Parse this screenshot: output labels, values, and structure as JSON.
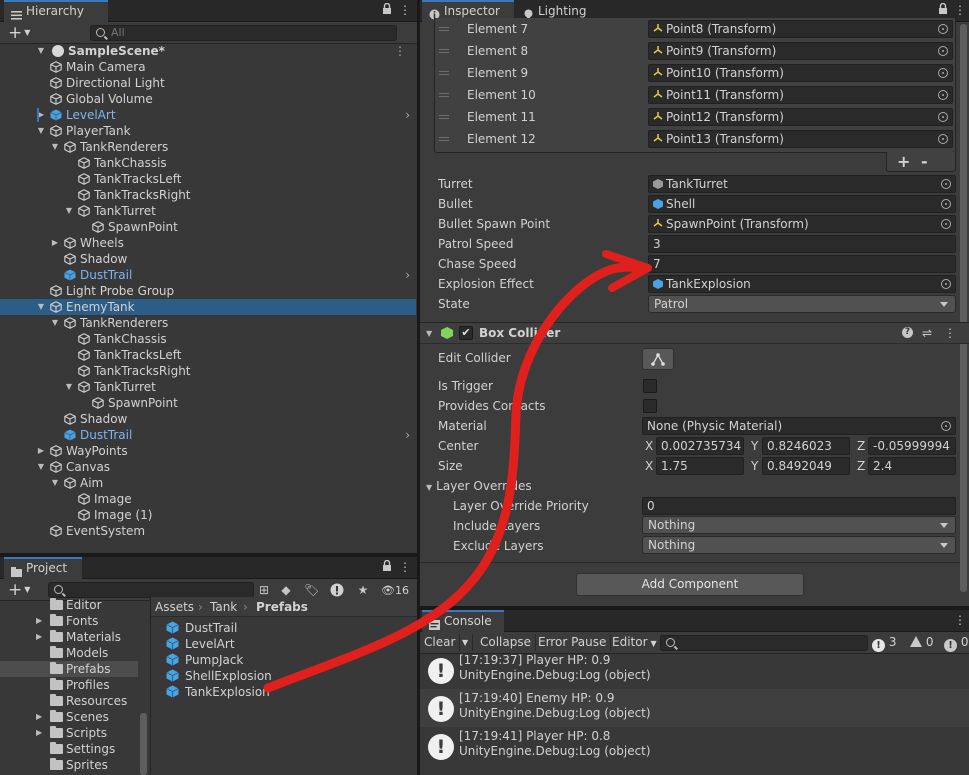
{
  "hierarchy": {
    "tab_label": "Hierarchy",
    "search_placeholder": "All",
    "scene_name": "SampleScene*",
    "items": [
      {
        "label": "Main Camera",
        "depth": 1,
        "arrow": "",
        "prefab": false,
        "sel": false,
        "chev": false
      },
      {
        "label": "Directional Light",
        "depth": 1,
        "arrow": "",
        "prefab": false,
        "sel": false,
        "chev": false
      },
      {
        "label": "Global Volume",
        "depth": 1,
        "arrow": "",
        "prefab": false,
        "sel": false,
        "chev": false
      },
      {
        "label": "LevelArt",
        "depth": 1,
        "arrow": "right",
        "prefab": true,
        "sel": false,
        "chev": true
      },
      {
        "label": "PlayerTank",
        "depth": 1,
        "arrow": "down",
        "prefab": false,
        "sel": false,
        "chev": false
      },
      {
        "label": "TankRenderers",
        "depth": 2,
        "arrow": "down",
        "prefab": false,
        "sel": false,
        "chev": false
      },
      {
        "label": "TankChassis",
        "depth": 3,
        "arrow": "",
        "prefab": false,
        "sel": false,
        "chev": false
      },
      {
        "label": "TankTracksLeft",
        "depth": 3,
        "arrow": "",
        "prefab": false,
        "sel": false,
        "chev": false
      },
      {
        "label": "TankTracksRight",
        "depth": 3,
        "arrow": "",
        "prefab": false,
        "sel": false,
        "chev": false
      },
      {
        "label": "TankTurret",
        "depth": 3,
        "arrow": "down",
        "prefab": false,
        "sel": false,
        "chev": false
      },
      {
        "label": "SpawnPoint",
        "depth": 4,
        "arrow": "",
        "prefab": false,
        "sel": false,
        "chev": false
      },
      {
        "label": "Wheels",
        "depth": 2,
        "arrow": "right",
        "prefab": false,
        "sel": false,
        "chev": false
      },
      {
        "label": "Shadow",
        "depth": 2,
        "arrow": "",
        "prefab": false,
        "sel": false,
        "chev": false
      },
      {
        "label": "DustTrail",
        "depth": 2,
        "arrow": "",
        "prefab": true,
        "sel": false,
        "chev": true
      },
      {
        "label": "Light Probe Group",
        "depth": 1,
        "arrow": "",
        "prefab": false,
        "sel": false,
        "chev": false
      },
      {
        "label": "EnemyTank",
        "depth": 1,
        "arrow": "down",
        "prefab": false,
        "sel": true,
        "chev": false
      },
      {
        "label": "TankRenderers",
        "depth": 2,
        "arrow": "down",
        "prefab": false,
        "sel": false,
        "chev": false
      },
      {
        "label": "TankChassis",
        "depth": 3,
        "arrow": "",
        "prefab": false,
        "sel": false,
        "chev": false
      },
      {
        "label": "TankTracksLeft",
        "depth": 3,
        "arrow": "",
        "prefab": false,
        "sel": false,
        "chev": false
      },
      {
        "label": "TankTracksRight",
        "depth": 3,
        "arrow": "",
        "prefab": false,
        "sel": false,
        "chev": false
      },
      {
        "label": "TankTurret",
        "depth": 3,
        "arrow": "down",
        "prefab": false,
        "sel": false,
        "chev": false
      },
      {
        "label": "SpawnPoint",
        "depth": 4,
        "arrow": "",
        "prefab": false,
        "sel": false,
        "chev": false
      },
      {
        "label": "Shadow",
        "depth": 2,
        "arrow": "",
        "prefab": false,
        "sel": false,
        "chev": false
      },
      {
        "label": "DustTrail",
        "depth": 2,
        "arrow": "",
        "prefab": true,
        "sel": false,
        "chev": true
      },
      {
        "label": "WayPoints",
        "depth": 1,
        "arrow": "right",
        "prefab": false,
        "sel": false,
        "chev": false
      },
      {
        "label": "Canvas",
        "depth": 1,
        "arrow": "down",
        "prefab": false,
        "sel": false,
        "chev": false
      },
      {
        "label": "Aim",
        "depth": 2,
        "arrow": "down",
        "prefab": false,
        "sel": false,
        "chev": false
      },
      {
        "label": "Image",
        "depth": 3,
        "arrow": "",
        "prefab": false,
        "sel": false,
        "chev": false
      },
      {
        "label": "Image (1)",
        "depth": 3,
        "arrow": "",
        "prefab": false,
        "sel": false,
        "chev": false
      },
      {
        "label": "EventSystem",
        "depth": 1,
        "arrow": "",
        "prefab": false,
        "sel": false,
        "chev": false
      }
    ]
  },
  "project": {
    "tab_label": "Project",
    "hidden_count": "16",
    "folders": [
      {
        "label": "Editor",
        "arrow": false,
        "sel": false
      },
      {
        "label": "Fonts",
        "arrow": true,
        "sel": false
      },
      {
        "label": "Materials",
        "arrow": true,
        "sel": false
      },
      {
        "label": "Models",
        "arrow": false,
        "sel": false
      },
      {
        "label": "Prefabs",
        "arrow": false,
        "sel": true
      },
      {
        "label": "Profiles",
        "arrow": false,
        "sel": false
      },
      {
        "label": "Resources",
        "arrow": false,
        "sel": false
      },
      {
        "label": "Scenes",
        "arrow": true,
        "sel": false
      },
      {
        "label": "Scripts",
        "arrow": true,
        "sel": false
      },
      {
        "label": "Settings",
        "arrow": false,
        "sel": false
      },
      {
        "label": "Sprites",
        "arrow": false,
        "sel": false
      }
    ],
    "breadcrumb": [
      "Assets",
      "Tank",
      "Prefabs"
    ],
    "assets": [
      "DustTrail",
      "LevelArt",
      "PumpJack",
      "ShellExplosion",
      "TankExplosion"
    ]
  },
  "inspector": {
    "tab_label": "Inspector",
    "tab2_label": "Lighting",
    "elements": [
      {
        "label": "Element 7",
        "value": "Point8 (Transform)"
      },
      {
        "label": "Element 8",
        "value": "Point9 (Transform)"
      },
      {
        "label": "Element 9",
        "value": "Point10 (Transform)"
      },
      {
        "label": "Element 10",
        "value": "Point11 (Transform)"
      },
      {
        "label": "Element 11",
        "value": "Point12 (Transform)"
      },
      {
        "label": "Element 12",
        "value": "Point13 (Transform)"
      }
    ],
    "plus_label": "+",
    "minus_label": "-",
    "props": {
      "turret_label": "Turret",
      "turret_value": "TankTurret",
      "bullet_label": "Bullet",
      "bullet_value": "Shell",
      "spawn_label": "Bullet Spawn Point",
      "spawn_value": "SpawnPoint (Transform)",
      "patrol_label": "Patrol Speed",
      "patrol_value": "3",
      "chase_label": "Chase Speed",
      "chase_value": "7",
      "explosion_label": "Explosion Effect",
      "explosion_value": "TankExplosion",
      "state_label": "State",
      "state_value": "Patrol"
    },
    "box_collider": {
      "title": "Box Collider",
      "edit_label": "Edit Collider",
      "trigger_label": "Is Trigger",
      "contacts_label": "Provides Contacts",
      "material_label": "Material",
      "material_value": "None (Physic Material)",
      "center_label": "Center",
      "center": {
        "x": "0.002735734",
        "y": "0.8246023",
        "z": "-0.05999994"
      },
      "size_label": "Size",
      "size": {
        "x": "1.75",
        "y": "0.8492049",
        "z": "2.4"
      },
      "axis_x": "X",
      "axis_y": "Y",
      "axis_z": "Z",
      "layer_overrides_label": "Layer Overrides",
      "priority_label": "Layer Override Priority",
      "priority_value": "0",
      "include_label": "Include Layers",
      "include_value": "Nothing",
      "exclude_label": "Exclude Layers",
      "exclude_value": "Nothing"
    },
    "add_component_label": "Add Component"
  },
  "console": {
    "tab_label": "Console",
    "clear_label": "Clear",
    "collapse_label": "Collapse",
    "error_pause_label": "Error Pause",
    "editor_label": "Editor",
    "warn_count": "3",
    "info_count": "0",
    "error_count": "0",
    "logs": [
      {
        "line1": "[17:19:37] Player HP: 0.9",
        "line2": "UnityEngine.Debug:Log (object)"
      },
      {
        "line1": "[17:19:40] Enemy HP: 0.9",
        "line2": "UnityEngine.Debug:Log (object)"
      },
      {
        "line1": "[17:19:41] Player HP: 0.8",
        "line2": "UnityEngine.Debug:Log (object)"
      }
    ]
  },
  "colors": {
    "accent": "#3a79bb",
    "selection": "#2c5d87",
    "prefab_text": "#7cb6f3",
    "annotation": "#e0201c"
  }
}
